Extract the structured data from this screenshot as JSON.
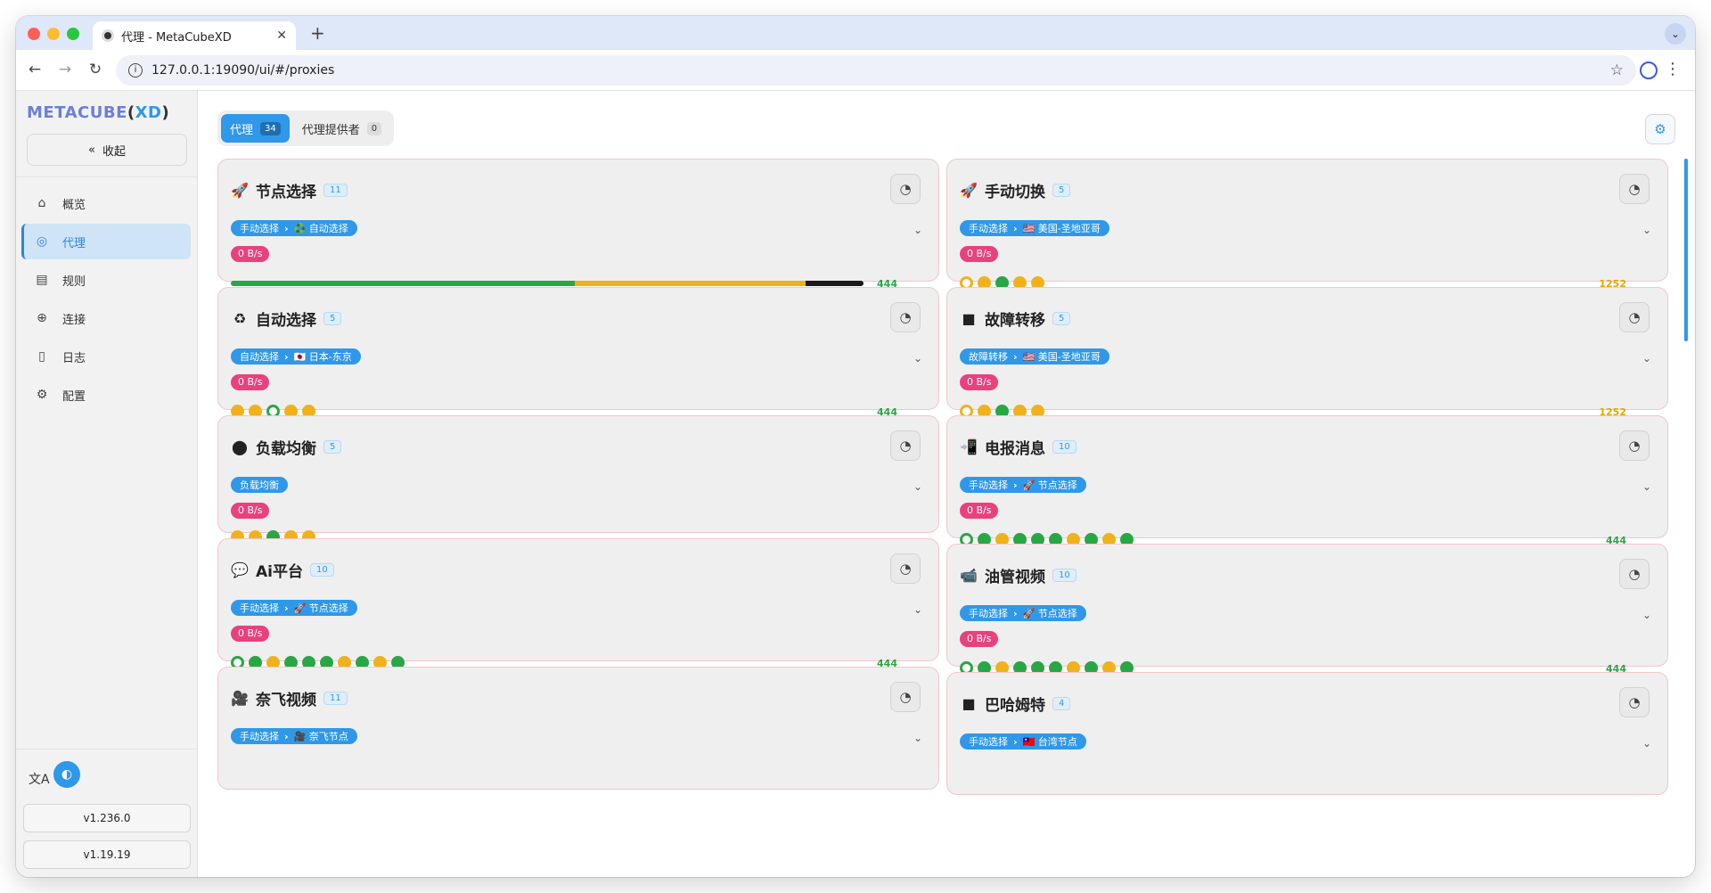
{
  "browser": {
    "tab_title": "代理 - MetaCubeXD",
    "url": "127.0.0.1:19090/ui/#/proxies",
    "new_tab": "+",
    "close": "✕"
  },
  "sidebar": {
    "logo_a": "METACUBE",
    "logo_b": "(",
    "logo_c": "XD",
    "logo_d": ")",
    "collapse_label": "收起",
    "items": [
      {
        "label": "概览",
        "icon": "home-icon",
        "glyph": "⌂"
      },
      {
        "label": "代理",
        "icon": "globe-icon",
        "glyph": "◎"
      },
      {
        "label": "规则",
        "icon": "rules-icon",
        "glyph": "▤"
      },
      {
        "label": "连接",
        "icon": "network-icon",
        "glyph": "⊕"
      },
      {
        "label": "日志",
        "icon": "log-icon",
        "glyph": "▯"
      },
      {
        "label": "配置",
        "icon": "gear-icon",
        "glyph": "⚙"
      }
    ],
    "version_ui": "v1.236.0",
    "version_core": "v1.19.19"
  },
  "main": {
    "tabs": [
      {
        "label": "代理",
        "count": "34"
      },
      {
        "label": "代理提供者",
        "count": "0"
      }
    ]
  },
  "colors": {
    "accent": "#2f98e8",
    "speed_badge": "#e8417e",
    "latency_good": "#28a745",
    "latency_mid": "#f0b21a"
  },
  "groups_left": [
    {
      "name": "节点选择",
      "icon": "rocket-icon",
      "glyph": "🚀",
      "count": "11",
      "chain": [
        "手动选择",
        "♻️ 自动选择"
      ],
      "speed": "0 B/s",
      "latency": "444",
      "latency_color": "green",
      "bar": [
        {
          "share": 0.44,
          "color": "#28a745"
        },
        {
          "share": 0.296,
          "color": "#f0b21a"
        },
        {
          "share": 0.074,
          "color": "#1a1a1a"
        }
      ]
    },
    {
      "name": "自动选择",
      "icon": "recycle-icon",
      "glyph": "♻",
      "count": "5",
      "chain": [
        "自动选择",
        "🇯🇵 日本-东京"
      ],
      "speed": "0 B/s",
      "latency": "444",
      "latency_color": "green",
      "dots": [
        "y",
        "y",
        "og",
        "y",
        "y"
      ]
    },
    {
      "name": "负载均衡",
      "icon": "balance-icon",
      "glyph": "⬤",
      "count": "5",
      "chain": [
        "负载均衡"
      ],
      "speed": "0 B/s",
      "latency": "",
      "latency_color": "green",
      "dots": [
        "y",
        "y",
        "g",
        "y",
        "y"
      ]
    },
    {
      "name": "Ai平台",
      "icon": "chat-icon",
      "glyph": "💬",
      "count": "10",
      "chain": [
        "手动选择",
        "🚀 节点选择"
      ],
      "speed": "0 B/s",
      "latency": "444",
      "latency_color": "green",
      "dots": [
        "og",
        "g",
        "y",
        "g",
        "g",
        "g",
        "y",
        "g",
        "y",
        "g"
      ]
    },
    {
      "name": "奈飞视频",
      "icon": "video-icon",
      "glyph": "🎥",
      "count": "11",
      "chain": [
        "手动选择",
        "🎥 奈飞节点"
      ],
      "speed": "",
      "latency": "",
      "latency_color": "green"
    }
  ],
  "groups_right": [
    {
      "name": "手动切换",
      "icon": "rocket-icon",
      "glyph": "🚀",
      "count": "5",
      "chain": [
        "手动选择",
        "🇺🇸 美国-圣地亚哥"
      ],
      "speed": "0 B/s",
      "latency": "1252",
      "latency_color": "yellow",
      "dots": [
        "oy",
        "y",
        "g",
        "y",
        "y"
      ]
    },
    {
      "name": "故障转移",
      "icon": "failover-icon",
      "glyph": "■",
      "count": "5",
      "chain": [
        "故障转移",
        "🇺🇸 美国-圣地亚哥"
      ],
      "speed": "0 B/s",
      "latency": "1252",
      "latency_color": "yellow",
      "dots": [
        "oy",
        "y",
        "g",
        "y",
        "y"
      ]
    },
    {
      "name": "电报消息",
      "icon": "telegram-icon",
      "glyph": "📲",
      "count": "10",
      "chain": [
        "手动选择",
        "🚀 节点选择"
      ],
      "speed": "0 B/s",
      "latency": "444",
      "latency_color": "green",
      "dots": [
        "og",
        "g",
        "y",
        "g",
        "g",
        "g",
        "y",
        "g",
        "y",
        "g"
      ]
    },
    {
      "name": "油管视频",
      "icon": "youtube-icon",
      "glyph": "📹",
      "count": "10",
      "chain": [
        "手动选择",
        "🚀 节点选择"
      ],
      "speed": "0 B/s",
      "latency": "444",
      "latency_color": "green",
      "dots": [
        "og",
        "g",
        "y",
        "g",
        "g",
        "g",
        "y",
        "g",
        "y",
        "g"
      ]
    },
    {
      "name": "巴哈姆特",
      "icon": "bahamut-icon",
      "glyph": "■",
      "count": "4",
      "chain": [
        "手动选择",
        "🇹🇼 台湾节点"
      ],
      "speed": "",
      "latency": "",
      "latency_color": "green"
    }
  ]
}
